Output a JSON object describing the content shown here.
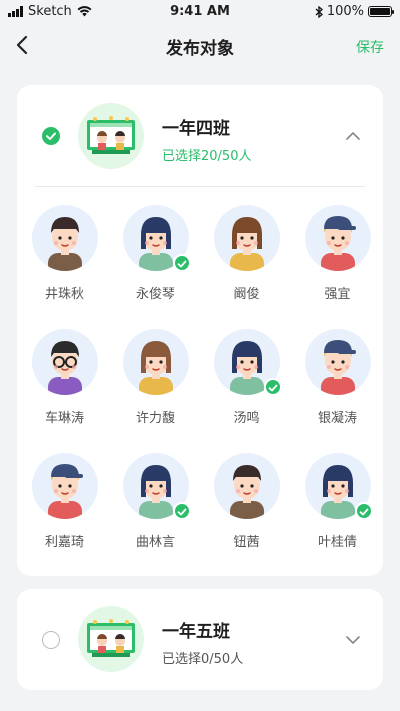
{
  "status_bar": {
    "carrier": "Sketch",
    "time": "9:41 AM",
    "battery": "100%"
  },
  "nav": {
    "title": "发布对象",
    "save_label": "保存"
  },
  "classes": [
    {
      "name": "一年四班",
      "selected_text": "已选择20/50人",
      "checked": true,
      "expanded": true,
      "students": [
        {
          "name": "井珠秋",
          "checked": false,
          "hair": "#3a2b2b",
          "style": "short",
          "shirt": "#7b5e47",
          "hat": ""
        },
        {
          "name": "永俊琴",
          "checked": true,
          "hair": "#2a3a66",
          "style": "long",
          "shirt": "#7fc0a0",
          "hat": ""
        },
        {
          "name": "阚俊",
          "checked": false,
          "hair": "#7a4a2a",
          "style": "long",
          "shirt": "#e8b94a",
          "hat": ""
        },
        {
          "name": "强宜",
          "checked": false,
          "hair": "#f0c070",
          "style": "short",
          "shirt": "#e35c5c",
          "hat": "#3b4f7a"
        },
        {
          "name": "车琳涛",
          "checked": false,
          "hair": "#2b2b2b",
          "style": "glasses",
          "shirt": "#8a5bc0",
          "hat": ""
        },
        {
          "name": "许力馥",
          "checked": false,
          "hair": "#8a5a3a",
          "style": "long",
          "shirt": "#e8b94a",
          "hat": ""
        },
        {
          "name": "汤鸣",
          "checked": true,
          "hair": "#2a3a66",
          "style": "long",
          "shirt": "#7fc0a0",
          "hat": ""
        },
        {
          "name": "银凝涛",
          "checked": false,
          "hair": "#f0c070",
          "style": "short",
          "shirt": "#e35c5c",
          "hat": "#3b4f7a"
        },
        {
          "name": "利嘉琦",
          "checked": false,
          "hair": "#f0c070",
          "style": "short",
          "shirt": "#e35c5c",
          "hat": "#3b4f7a"
        },
        {
          "name": "曲林言",
          "checked": true,
          "hair": "#2a3a66",
          "style": "long",
          "shirt": "#7fc0a0",
          "hat": ""
        },
        {
          "name": "钮茜",
          "checked": false,
          "hair": "#3a2b2b",
          "style": "short",
          "shirt": "#7b5e47",
          "hat": ""
        },
        {
          "name": "叶桂倩",
          "checked": true,
          "hair": "#2a3a66",
          "style": "long",
          "shirt": "#7fc0a0",
          "hat": ""
        }
      ]
    },
    {
      "name": "一年五班",
      "selected_text": "已选择0/50人",
      "checked": false,
      "expanded": false,
      "students": []
    }
  ],
  "colors": {
    "accent": "#2bbd6a",
    "count_active": "#2bbd6a",
    "count_inactive": "#555555"
  }
}
